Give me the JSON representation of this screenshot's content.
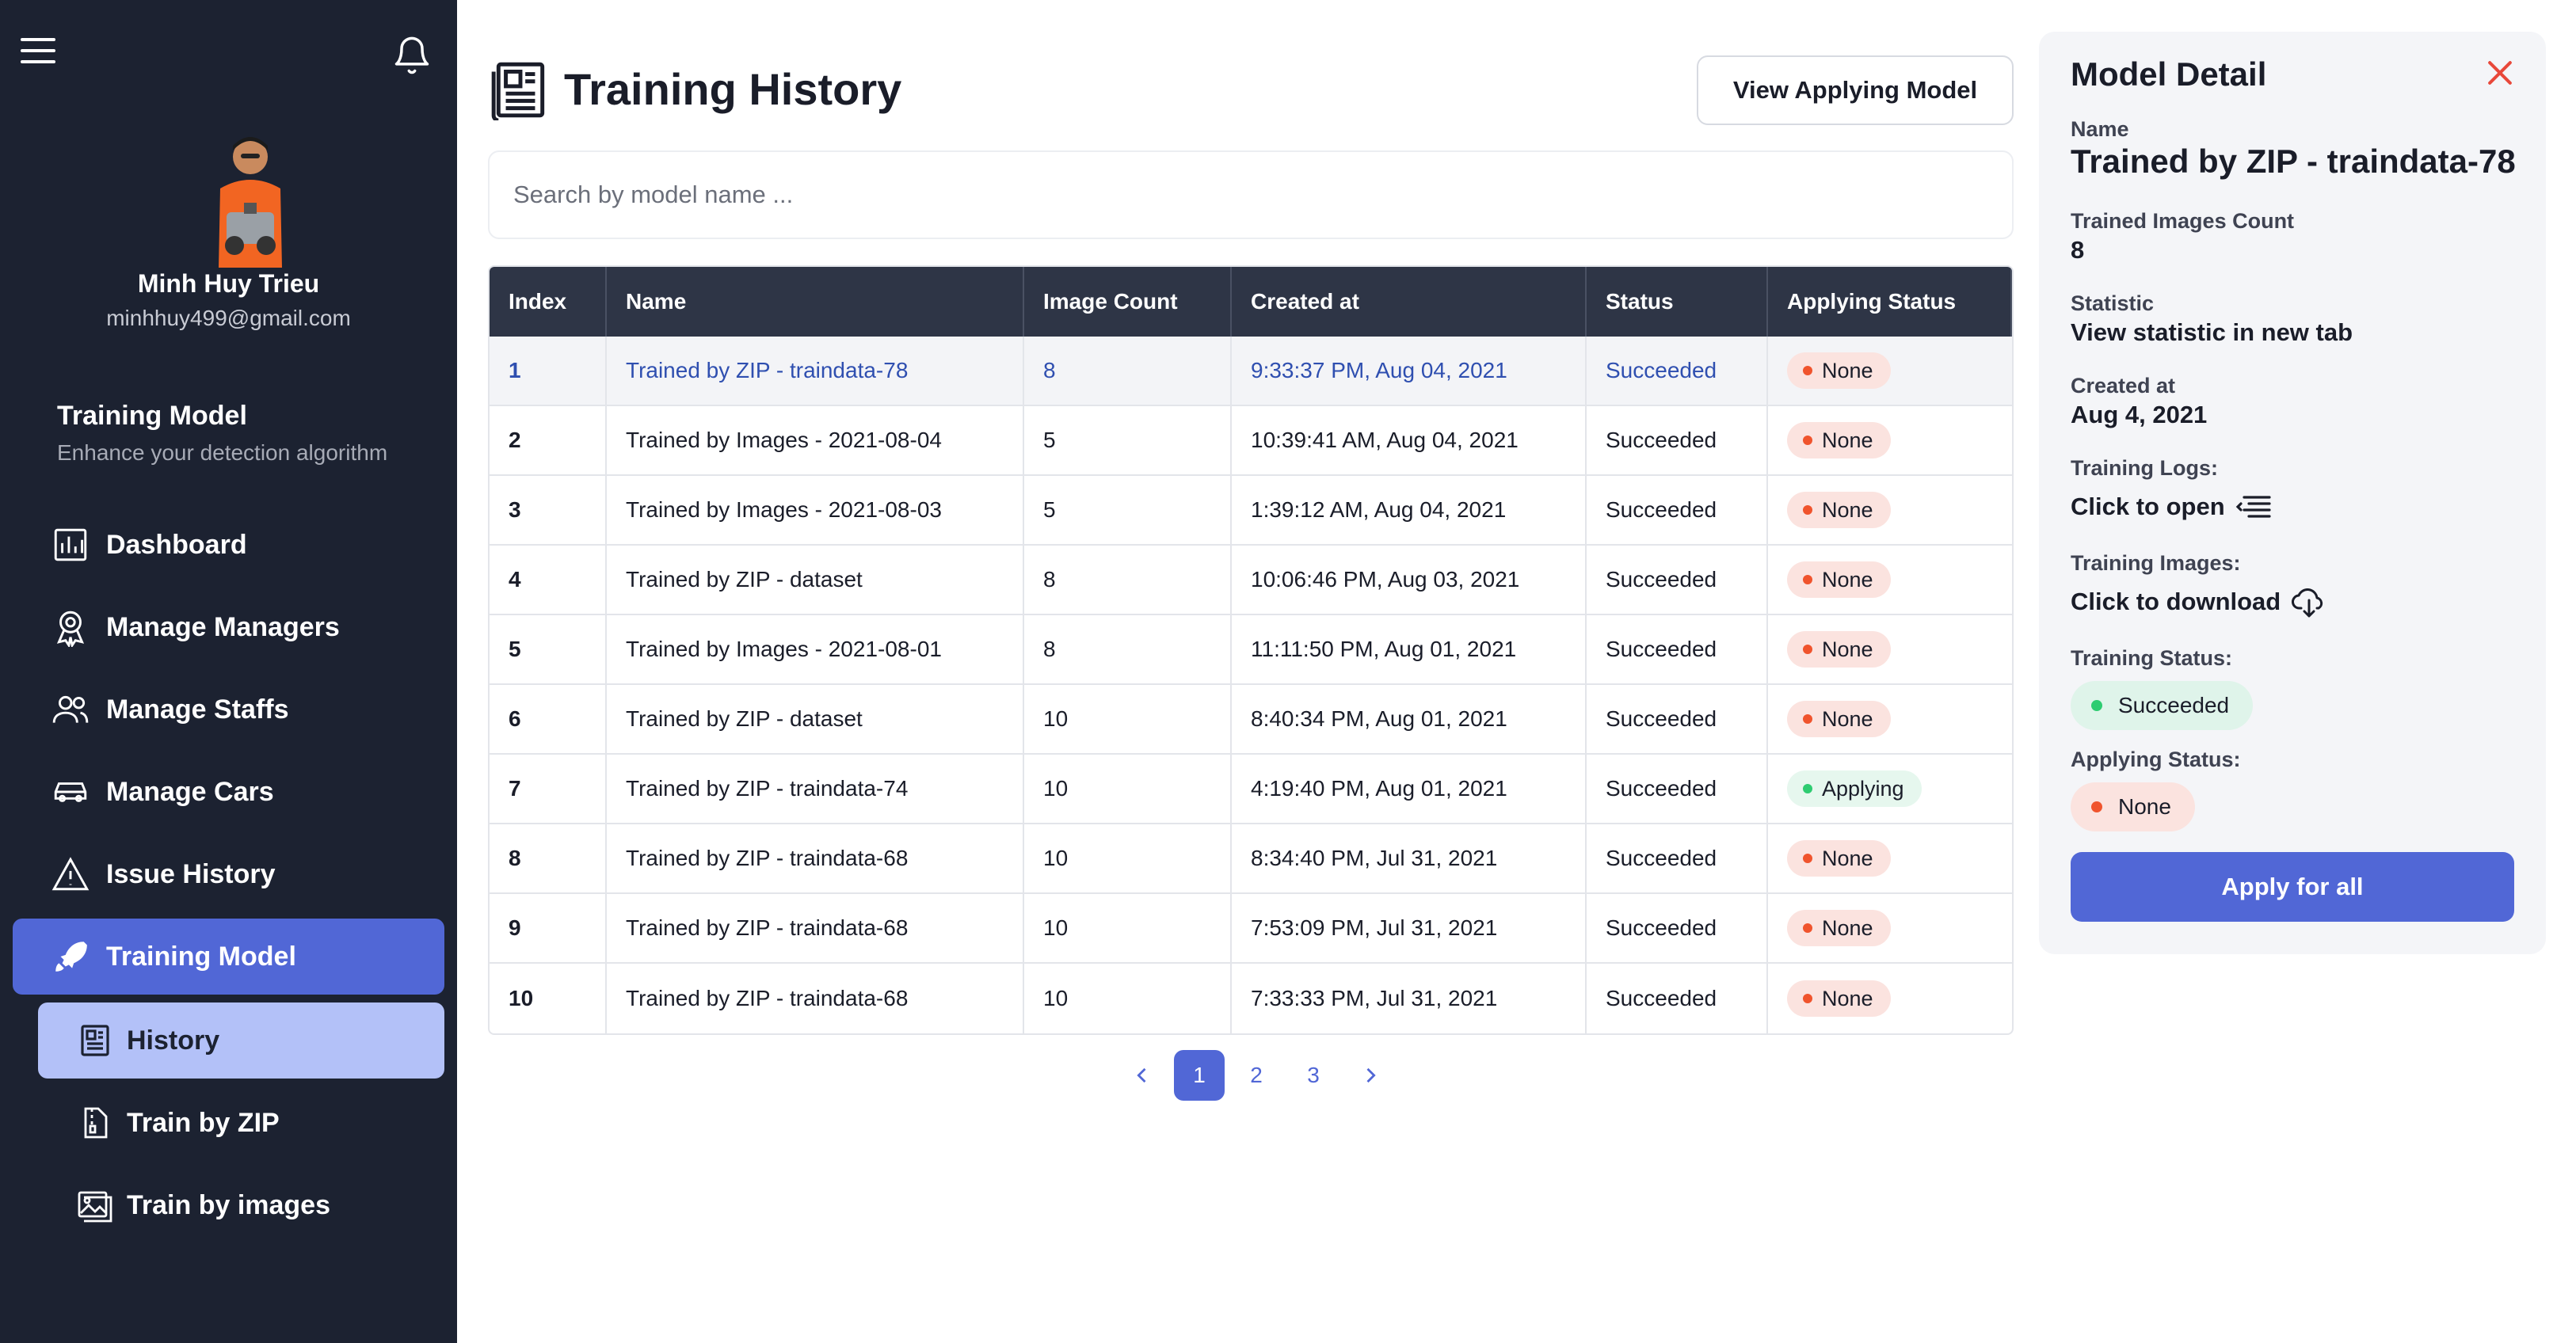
{
  "user": {
    "name": "Minh Huy Trieu",
    "email": "minhhuy499@gmail.com"
  },
  "section": {
    "title": "Training Model",
    "subtitle": "Enhance your detection algorithm"
  },
  "nav": [
    {
      "label": "Dashboard",
      "icon": "chart-icon"
    },
    {
      "label": "Manage Managers",
      "icon": "badge-icon"
    },
    {
      "label": "Manage Staffs",
      "icon": "users-icon"
    },
    {
      "label": "Manage Cars",
      "icon": "car-icon"
    },
    {
      "label": "Issue History",
      "icon": "warning-icon"
    },
    {
      "label": "Training Model",
      "icon": "rocket-icon"
    }
  ],
  "subnav": [
    {
      "label": "History",
      "icon": "document-icon"
    },
    {
      "label": "Train by ZIP",
      "icon": "zip-file-icon"
    },
    {
      "label": "Train by images",
      "icon": "images-icon"
    }
  ],
  "page": {
    "title": "Training History",
    "view_applying_label": "View Applying Model",
    "search_placeholder": "Search by model name ..."
  },
  "table": {
    "headers": [
      "Index",
      "Name",
      "Image Count",
      "Created at",
      "Status",
      "Applying Status"
    ],
    "rows": [
      {
        "index": "1",
        "name": "Trained by ZIP - traindata-78",
        "count": "8",
        "created": "9:33:37 PM, Aug 04, 2021",
        "status": "Succeeded",
        "applying": "None"
      },
      {
        "index": "2",
        "name": "Trained by Images - 2021-08-04",
        "count": "5",
        "created": "10:39:41 AM, Aug 04, 2021",
        "status": "Succeeded",
        "applying": "None"
      },
      {
        "index": "3",
        "name": "Trained by Images - 2021-08-03",
        "count": "5",
        "created": "1:39:12 AM, Aug 04, 2021",
        "status": "Succeeded",
        "applying": "None"
      },
      {
        "index": "4",
        "name": "Trained by ZIP - dataset",
        "count": "8",
        "created": "10:06:46 PM, Aug 03, 2021",
        "status": "Succeeded",
        "applying": "None"
      },
      {
        "index": "5",
        "name": "Trained by Images - 2021-08-01",
        "count": "8",
        "created": "11:11:50 PM, Aug 01, 2021",
        "status": "Succeeded",
        "applying": "None"
      },
      {
        "index": "6",
        "name": "Trained by ZIP - dataset",
        "count": "10",
        "created": "8:40:34 PM, Aug 01, 2021",
        "status": "Succeeded",
        "applying": "None"
      },
      {
        "index": "7",
        "name": "Trained by ZIP - traindata-74",
        "count": "10",
        "created": "4:19:40 PM, Aug 01, 2021",
        "status": "Succeeded",
        "applying": "Applying"
      },
      {
        "index": "8",
        "name": "Trained by ZIP - traindata-68",
        "count": "10",
        "created": "8:34:40 PM, Jul 31, 2021",
        "status": "Succeeded",
        "applying": "None"
      },
      {
        "index": "9",
        "name": "Trained by ZIP - traindata-68",
        "count": "10",
        "created": "7:53:09 PM, Jul 31, 2021",
        "status": "Succeeded",
        "applying": "None"
      },
      {
        "index": "10",
        "name": "Trained by ZIP - traindata-68",
        "count": "10",
        "created": "7:33:33 PM, Jul 31, 2021",
        "status": "Succeeded",
        "applying": "None"
      }
    ]
  },
  "pagination": {
    "pages": [
      "1",
      "2",
      "3"
    ],
    "current": "1"
  },
  "detail": {
    "title": "Model Detail",
    "name_label": "Name",
    "name_value": "Trained by ZIP - traindata-78",
    "count_label": "Trained Images Count",
    "count_value": "8",
    "statistic_label": "Statistic",
    "statistic_value": "View statistic in new tab",
    "created_label": "Created at",
    "created_value": "Aug 4, 2021",
    "logs_label": "Training Logs:",
    "logs_value": "Click to open",
    "images_label": "Training Images:",
    "images_value": "Click to download",
    "status_label": "Training Status:",
    "status_value": "Succeeded",
    "applying_label": "Applying Status:",
    "applying_value": "None",
    "apply_button": "Apply for all"
  },
  "colors": {
    "sidebar": "#1c2231",
    "accent": "#5167d6",
    "accent_light": "#b3c1f8",
    "table_header": "#2e3546",
    "danger": "#e8483a"
  }
}
